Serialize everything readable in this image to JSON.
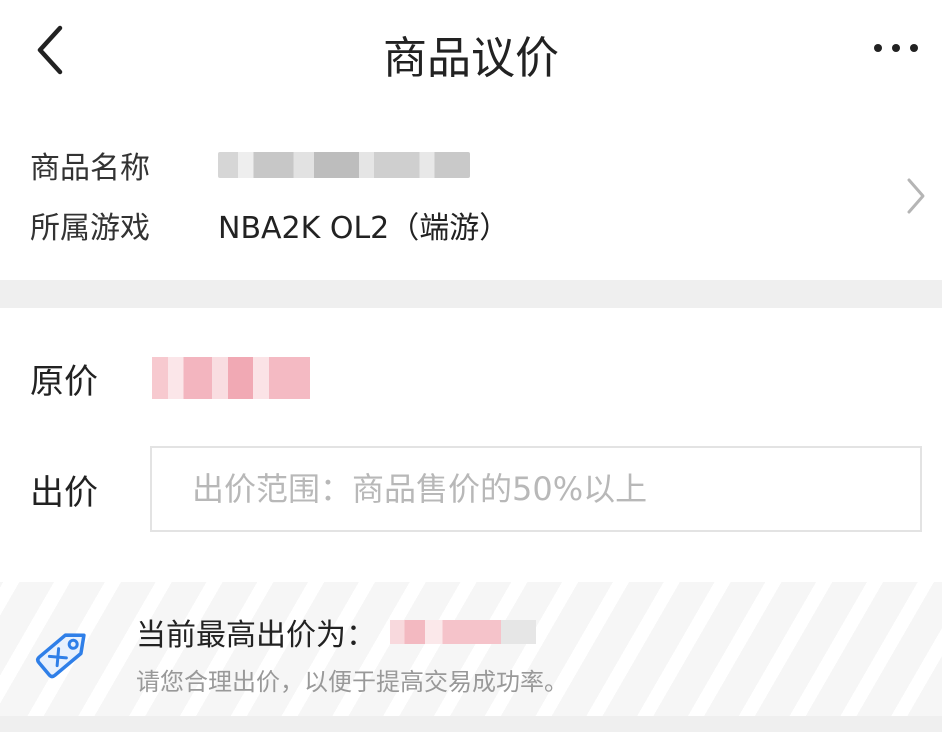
{
  "header": {
    "title": "商品议价",
    "back_icon": "chevron-left-icon",
    "more_icon": "more-horizontal-icon"
  },
  "product": {
    "name_label": "商品名称",
    "game_label": "所属游戏",
    "game_value": "NBA2K OL2（端游）",
    "detail_icon": "chevron-right-icon"
  },
  "price": {
    "original_label": "原价"
  },
  "offer": {
    "label": "出价",
    "placeholder": "出价范围：商品售价的50%以上",
    "value": ""
  },
  "tip": {
    "icon": "price-tag-icon",
    "highest_label": "当前最高出价为：",
    "note": "请您合理出价，以便于提高交易成功率。"
  },
  "colors": {
    "accent": "#2f7fe8",
    "divider": "#efefef",
    "redacted_price": "#f3b5bf"
  }
}
